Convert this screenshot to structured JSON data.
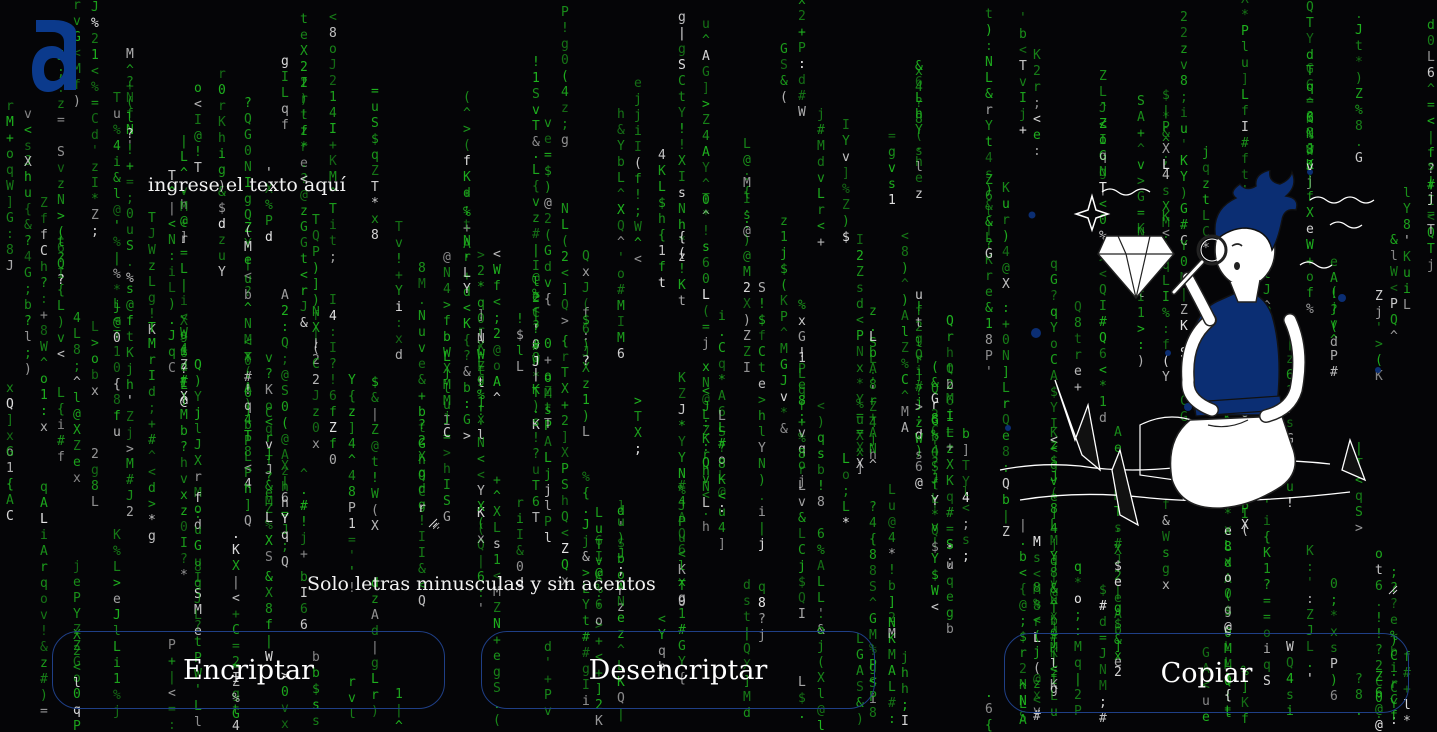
{
  "brand": {
    "logo_letter": "a",
    "logo_color": "#0b3a8c"
  },
  "encryptor": {
    "input_placeholder": "ingrese el texto aquí",
    "hint": "Solo letras minusculas y sin acentos"
  },
  "buttons": {
    "encrypt_label": "Encriptar",
    "decrypt_label": "Desencriptar",
    "copy_label": "Copiar"
  },
  "theme": {
    "background": "#050507",
    "matrix_green": "#1fb51f",
    "matrix_white": "#e8e8e8",
    "button_border": "#1f3f86",
    "illustration_accent": "#0b2e73"
  },
  "illustration": {
    "icon": "person-with-magnifying-glass-and-diamond"
  }
}
